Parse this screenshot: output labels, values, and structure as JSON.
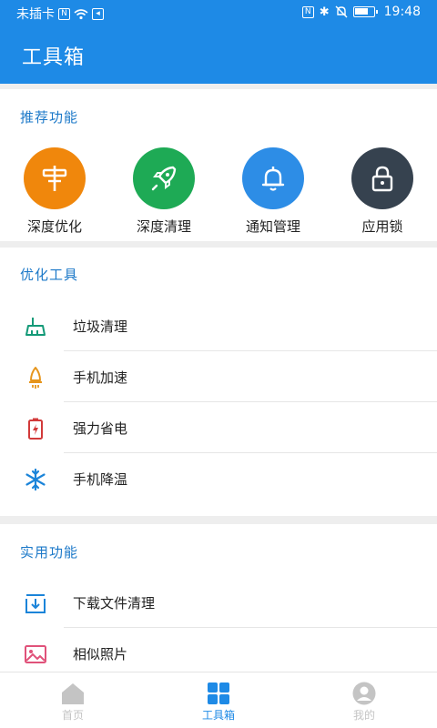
{
  "status_bar": {
    "left_text": "未插卡",
    "time": "19:48"
  },
  "app_bar": {
    "title": "工具箱"
  },
  "recommended": {
    "section_title": "推荐功能",
    "items": [
      {
        "label": "深度优化",
        "icon": "optimize-icon",
        "color": "#f0870c"
      },
      {
        "label": "深度清理",
        "icon": "rocket-icon",
        "color": "#1eaa55"
      },
      {
        "label": "通知管理",
        "icon": "bell-icon",
        "color": "#2d8de6"
      },
      {
        "label": "应用锁",
        "icon": "lock-icon",
        "color": "#36424f"
      }
    ]
  },
  "optimize_tools": {
    "section_title": "优化工具",
    "items": [
      {
        "label": "垃圾清理",
        "icon": "broom-icon",
        "color": "#149a78"
      },
      {
        "label": "手机加速",
        "icon": "rocket-icon",
        "color": "#e6951c"
      },
      {
        "label": "强力省电",
        "icon": "battery-icon",
        "color": "#d23a3a"
      },
      {
        "label": "手机降温",
        "icon": "snowflake-icon",
        "color": "#1b84d9"
      }
    ]
  },
  "utilities": {
    "section_title": "实用功能",
    "items": [
      {
        "label": "下载文件清理",
        "icon": "download-icon",
        "color": "#1b84d9"
      },
      {
        "label": "相似照片",
        "icon": "image-icon",
        "color": "#e0527a"
      }
    ]
  },
  "tab_bar": {
    "active_color": "#1e8ae6",
    "inactive_color": "#c4c4c4",
    "tabs": [
      {
        "label": "首页",
        "icon": "home-icon"
      },
      {
        "label": "工具箱",
        "icon": "grid-icon"
      },
      {
        "label": "我的",
        "icon": "user-icon"
      }
    ]
  }
}
